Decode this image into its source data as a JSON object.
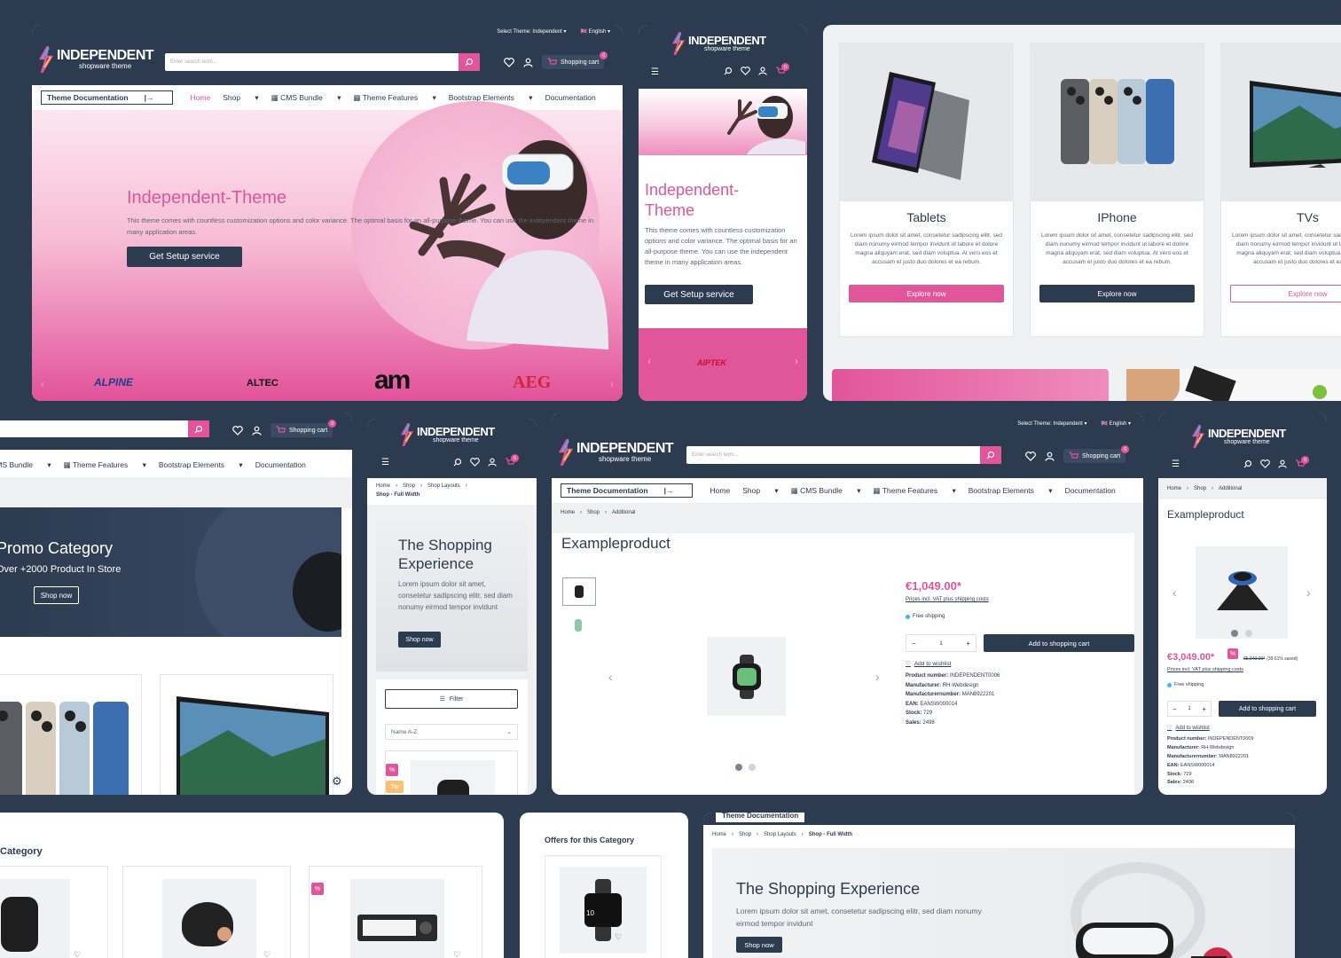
{
  "brand": {
    "name": "INDEPENDENT",
    "tagline": "shopware theme"
  },
  "topbar": {
    "theme_select": "Select Theme: Independent",
    "language": "English"
  },
  "search": {
    "placeholder": "Enter search term..."
  },
  "header": {
    "cart_label": "Shopping cart",
    "cart_count": "0"
  },
  "nav": {
    "doc_button": "Theme Documentation",
    "items": [
      "Home",
      "Shop",
      "CMS Bundle",
      "Theme Features",
      "Bootstrap Elements",
      "Documentation"
    ]
  },
  "hero": {
    "title": "Independent-Theme",
    "title_mobile_1": "Independent-",
    "title_mobile_2": "Theme",
    "text": "This theme comes with countless customization options and color variance. The optimal basis for an all-purpose theme. You can use the independent theme in many application areas.",
    "text_mobile": "This theme comes with countless customization options and color variance. The optimal basis for an all-purpose theme. You can use the independent theme in many application areas.",
    "cta": "Get Setup service"
  },
  "brands": [
    "ALPINE",
    "ALTEC",
    "am",
    "AEG",
    "AIPTEK"
  ],
  "categories": [
    {
      "name": "Tablets",
      "cta": "Explore now",
      "style": "pink"
    },
    {
      "name": "IPhone",
      "cta": "Explore now",
      "style": "navy"
    },
    {
      "name": "TVs",
      "cta": "Explore now",
      "style": "outline"
    }
  ],
  "lorem": "Lorem ipsum dolor sit amet, consetetur sadipscing elitr, sed diam nonumy eirmod tempor invidunt ut labore et dolore magna aliquyam erat, sed diam voluptua. At vero eos et accusam et justo duo dolores et ea rebum.",
  "promo": {
    "title": "Promo Category",
    "subtitle": "Over +2000 Product In Store",
    "cta": "Shop now"
  },
  "shopping_exp": {
    "title": "The Shopping Experience",
    "text": "Lorem ipsum dolor sit amet, consetetur sadipscing elitr, sed diam nonumy eirmod tempor invidunt",
    "cta": "Shop now"
  },
  "mobile_list": {
    "breadcrumb": [
      "Home",
      "Shop",
      "Shop Layouts"
    ],
    "current": "Shop - Full Width",
    "filter": "Filter",
    "sort": "Name A-Z",
    "badge_sale": "%",
    "badge_tip": "Tip"
  },
  "product": {
    "breadcrumb": [
      "Home",
      "Shop",
      "Additional"
    ],
    "name": "Exampleproduct",
    "price": "€1,049.00*",
    "price_note": "Prices incl. VAT plus shipping costs",
    "shipping": "Free shipping",
    "qty": "1",
    "add_to_cart": "Add to shopping cart",
    "wishlist": "Add to wishlist",
    "details": [
      {
        "label": "Product number:",
        "value": "INDEPENDENT0006"
      },
      {
        "label": "Manufacturer:",
        "value": "RH-Webdesign"
      },
      {
        "label": "Manufacturernumber:",
        "value": "MAN8922201"
      },
      {
        "label": "EAN:",
        "value": "EANSW000014"
      },
      {
        "label": "Stock:",
        "value": "729"
      },
      {
        "label": "Sales:",
        "value": "2498"
      }
    ]
  },
  "product_mobile": {
    "name": "Exampleproduct",
    "price": "€3,049.00*",
    "badge": "%",
    "old_price": "€5,049.00*",
    "saved": "(39.61% saved)",
    "price_note": "Prices incl. VAT plus shipping costs",
    "shipping": "Free shipping",
    "qty": "1",
    "add_to_cart": "Add to shopping cart",
    "wishlist": "Add to wishlist",
    "details": [
      {
        "label": "Product number:",
        "value": "INDEPENDENT0009"
      },
      {
        "label": "Manufacturer:",
        "value": "RH-Webdesign"
      },
      {
        "label": "Manufacturernumber:",
        "value": "MAN8922201"
      },
      {
        "label": "EAN:",
        "value": "EANSW000014"
      },
      {
        "label": "Stock:",
        "value": "729"
      },
      {
        "label": "Sales:",
        "value": "2498"
      }
    ]
  },
  "bottom": {
    "category_title": "Category",
    "offers_title": "Offers for this Category",
    "sale_badge": "%",
    "watch_label": "10"
  },
  "bottom_right": {
    "breadcrumb": [
      "Home",
      "Shop",
      "Shop Layouts"
    ],
    "current": "Shop - Full Width",
    "title": "The Shopping Experience",
    "text": "Lorem ipsum dolor sit amet, consetetur sadipscing elitr, sed diam nonumy eirmod tempor invidunt",
    "cta": "Shop now"
  },
  "colors": {
    "bg": "#2d3b50",
    "accent": "#e1559a",
    "navy": "#2d3b50"
  }
}
